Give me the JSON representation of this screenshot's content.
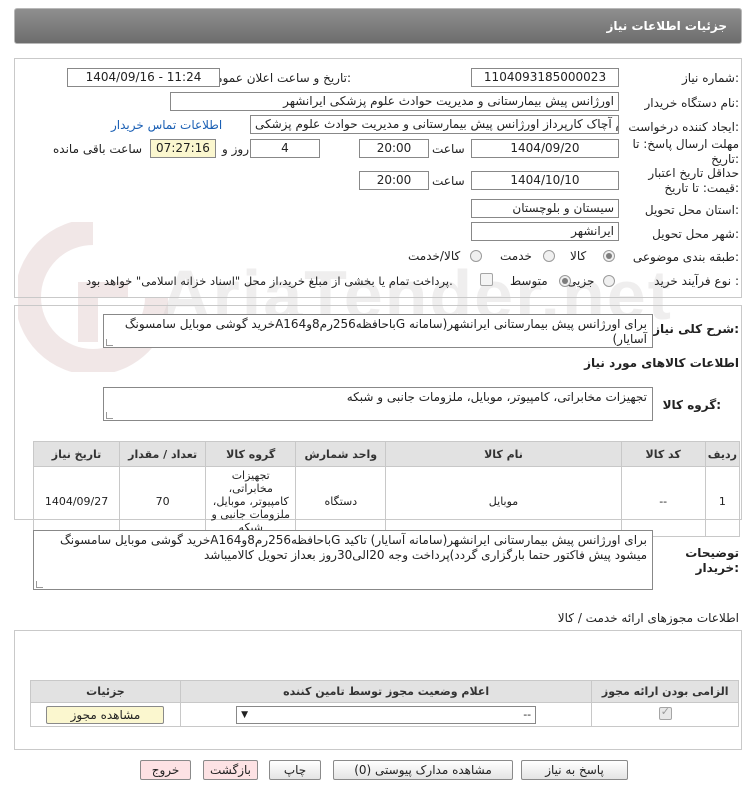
{
  "header": {
    "title": "جزئیات اطلاعات نیاز"
  },
  "form": {
    "need_number_label": "شماره نیاز:",
    "need_number": "1104093185000023",
    "announce_label": "تاریخ و ساعت اعلان عمومی:",
    "announce_value": "1404/09/16 - 11:24",
    "buyer_org_label": "نام دستگاه خریدار:",
    "buyer_org": "اورژانس پیش بیمارستانی و مدیریت حوادث علوم پزشکی ایرانشهر",
    "creator_label": "ایجاد کننده درخواست:",
    "creator": "محمداکرم آچاک کارپرداز اورژانس پیش بیمارستانی و مدیریت حوادث علوم پزشکی",
    "contact_link": "اطلاعات تماس خریدار",
    "deadline_label": "مهلت ارسال پاسخ: تا تاریخ:",
    "deadline_date": "1404/09/20",
    "time_label": "ساعت",
    "deadline_time": "20:00",
    "day_count": "4",
    "day_and_label": "روز و",
    "remaining_time": "07:27:16",
    "remaining_label": "ساعت باقی مانده",
    "validity_label": "حداقل تاریخ اعتبار قیمت: تا تاریخ:",
    "validity_date": "1404/10/10",
    "validity_time": "20:00",
    "province_label": "استان محل تحویل:",
    "province": "سیستان و بلوچستان",
    "city_label": "شهر محل تحویل:",
    "city": "ایرانشهر",
    "category_label": "طبقه بندی موضوعی:",
    "category_options": [
      "کالا",
      "خدمت",
      "کالا/خدمت"
    ],
    "process_label": "نوع فرآیند خرید :",
    "process_options": [
      "جزیی",
      "متوسط"
    ],
    "payment_note": "پرداخت تمام یا بخشی از مبلغ خرید،از محل \"اسناد خزانه اسلامی\" خواهد بود."
  },
  "summary": {
    "label": "شرح کلی نیاز:",
    "text": "خرید گوشی موبایل سامسونگA16باحافظه256رم8و4G برای اورژانس پیش بیمارستانی ایرانشهر(سامانه آسایار)",
    "goods_info_title": "اطلاعات کالاهای مورد نیاز",
    "goods_group_label": "گروه کالا:",
    "goods_group": "تجهیزات مخابراتی، کامپیوتر، موبایل، ملزومات جانبی و شبکه"
  },
  "items_table": {
    "headers": [
      "ردیف",
      "کد کالا",
      "نام کالا",
      "واحد شمارش",
      "گروه کالا",
      "تعداد / مقدار",
      "تاریخ نیاز"
    ],
    "rows": [
      {
        "row": "1",
        "code": "--",
        "name": "موبایل",
        "unit": "دستگاه",
        "group": "تجهیزات مخابراتی، کامپیوتر، موبایل، ملزومات جانبی و شبکه",
        "qty": "70",
        "date": "1404/09/27"
      }
    ]
  },
  "buyer_notes": {
    "label": "توضیحات خریدار:",
    "text": "خرید گوشی موبایل سامسونگA16باحافظه256رم8و4G برای اورژانس پیش بیمارستانی ایرانشهر(سامانه آسایار) تاکید میشود پیش فاکتور حتما بارگزاری گردد)پرداخت وجه 20الی30روز بعداز تحویل کالامیباشد"
  },
  "permits": {
    "title": "اطلاعات مجوزهای ارائه خدمت / کالا",
    "headers": [
      "الزامی بودن ارائه مجوز",
      "اعلام وضعیت مجوز توسط تامین کننده",
      "جزئیات"
    ],
    "select_value": "--",
    "view_button": "مشاهده مجوز"
  },
  "footer_buttons": {
    "reply": "پاسخ به نیاز",
    "attachments": "مشاهده مدارک پیوستی (0)",
    "print": "چاپ",
    "back": "بازگشت",
    "exit": "خروج"
  },
  "watermark": "AriaTender.net",
  "colors": {
    "header_bg": "#7d7d7d",
    "link": "#1a5fb4",
    "timer_bg": "#fbf7cf",
    "button_pink": "#fde2e4"
  }
}
